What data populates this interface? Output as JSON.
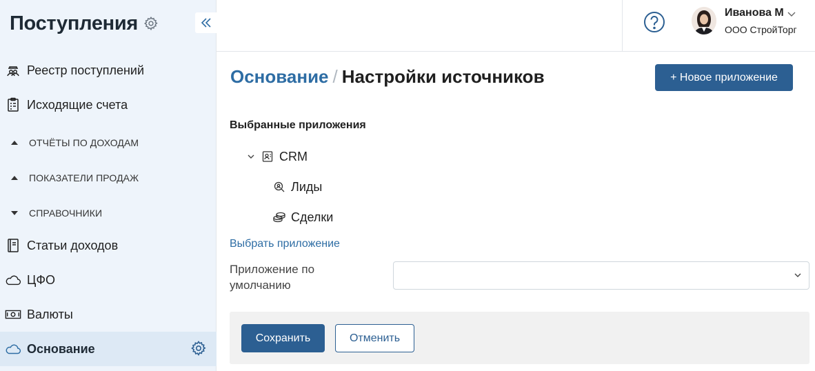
{
  "sidebar": {
    "title": "Поступления",
    "items": [
      {
        "label": "Реестр поступлений",
        "icon": "people-group-icon"
      },
      {
        "label": "Исходящие счета",
        "icon": "clipboard-list-icon"
      },
      {
        "label": "ОТЧЁТЫ ПО ДОХОДАМ",
        "icon": "triangle-up-icon",
        "section": true
      },
      {
        "label": "ПОКАЗАТЕЛИ ПРОДАЖ",
        "icon": "triangle-up-icon",
        "section": true
      },
      {
        "label": "СПРАВОЧНИКИ",
        "icon": "triangle-down-icon",
        "section": true
      },
      {
        "label": "Статьи доходов",
        "icon": "book-icon"
      },
      {
        "label": "ЦФО",
        "icon": "cloud-icon"
      },
      {
        "label": "Валюты",
        "icon": "banknote-icon"
      },
      {
        "label": "Основание",
        "icon": "cloud-icon",
        "active": true
      }
    ]
  },
  "header": {
    "user_name": "Иванова М",
    "company": "ООО СтройТорг"
  },
  "main": {
    "breadcrumb": {
      "parent": "Основание",
      "separator": "/",
      "current": "Настройки источников"
    },
    "new_app_button": "+ Новое приложение",
    "selected_apps_label": "Выбранные приложения",
    "tree": {
      "root": {
        "label": "CRM",
        "icon": "contact-card-icon"
      },
      "children": [
        {
          "label": "Лиды",
          "icon": "search-person-icon"
        },
        {
          "label": "Сделки",
          "icon": "coins-stack-icon"
        }
      ]
    },
    "choose_app_link": "Выбрать приложение",
    "default_app": {
      "label": "Приложение по умолчанию",
      "value": ""
    },
    "save_button": "Сохранить",
    "cancel_button": "Отменить"
  },
  "colors": {
    "accent": "#2c5f92",
    "link": "#2e6da4",
    "sidebar_bg": "#eef4fb",
    "sidebar_active": "#dde9f5"
  }
}
